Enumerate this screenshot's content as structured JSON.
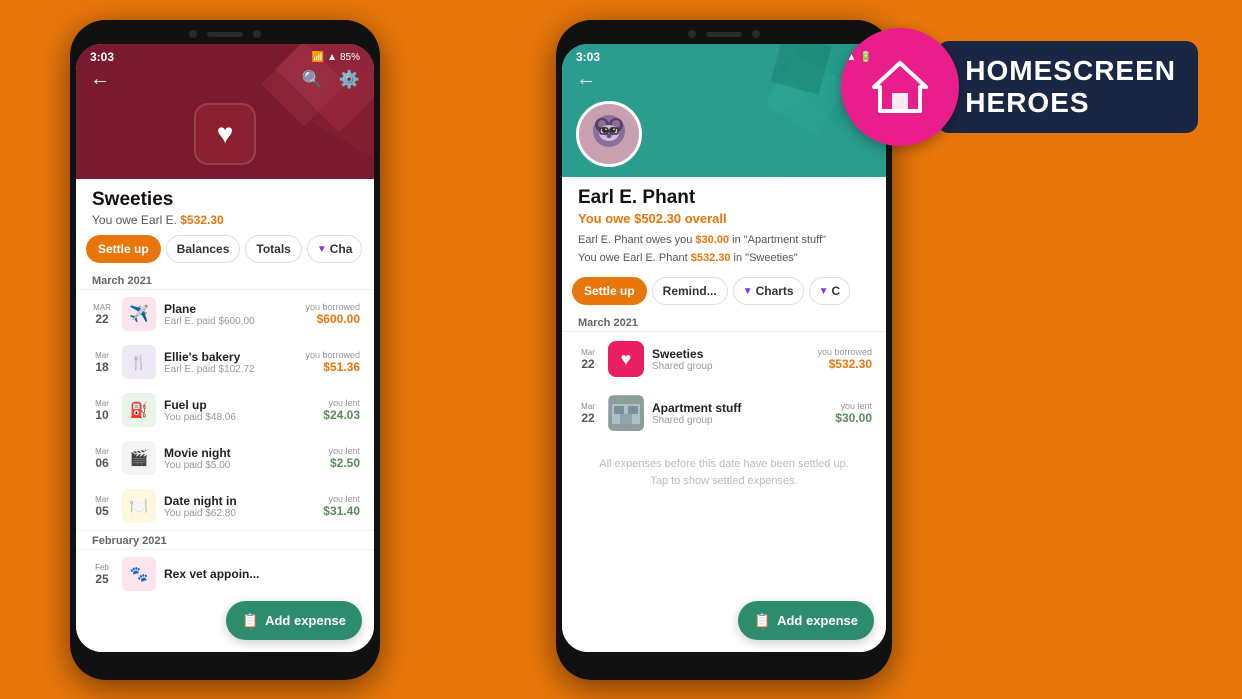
{
  "background_color": "#E8760A",
  "phone1": {
    "status": {
      "time": "3:03",
      "battery": "85%"
    },
    "header": {
      "back_label": "←",
      "search_label": "🔍",
      "settings_label": "⚙"
    },
    "group_name": "Sweeties",
    "group_subtitle": "You owe Earl E.",
    "owe_amount": "$532.30",
    "tabs": [
      {
        "label": "Settle up",
        "active": true
      },
      {
        "label": "Balances",
        "active": false
      },
      {
        "label": "Totals",
        "active": false
      },
      {
        "label": "Cha...",
        "active": false,
        "has_icon": true
      }
    ],
    "month_label": "March 2021",
    "expenses": [
      {
        "month": "Mar",
        "day": "22",
        "icon": "✈",
        "icon_bg": "pink",
        "name": "Plane",
        "payer": "Earl E. paid $600.00",
        "status": "you borrowed",
        "amount": "$600.00",
        "type": "borrowed"
      },
      {
        "month": "Mar",
        "day": "18",
        "icon": "🍴",
        "icon_bg": "purple",
        "name": "Ellie's bakery",
        "payer": "Earl E. paid $102.72",
        "status": "you borrowed",
        "amount": "$51.36",
        "type": "borrowed"
      },
      {
        "month": "Mar",
        "day": "10",
        "icon": "⛽",
        "icon_bg": "green",
        "name": "Fuel up",
        "payer": "You paid $48.06",
        "status": "you lent",
        "amount": "$24.03",
        "type": "lent"
      },
      {
        "month": "Mar",
        "day": "06",
        "icon": "🎬",
        "icon_bg": "gray",
        "name": "Movie night",
        "payer": "You paid $5.00",
        "status": "you lent",
        "amount": "$2.50",
        "type": "lent"
      },
      {
        "month": "Mar",
        "day": "05",
        "icon": "🍽",
        "icon_bg": "yellow",
        "name": "Date night in",
        "payer": "You paid $62.80",
        "status": "you lent",
        "amount": "$31.40",
        "type": "lent"
      }
    ],
    "february_label": "February 2021",
    "february_expense": {
      "month": "Feb",
      "day": "25",
      "icon": "🐾",
      "icon_bg": "pink",
      "name": "Rex vet appoin...",
      "payer": "",
      "status": "",
      "amount": "",
      "type": ""
    },
    "add_expense_label": "Add expense"
  },
  "phone2": {
    "status": {
      "time": "3:03"
    },
    "header": {
      "back_label": "←"
    },
    "contact_name": "Earl E. Phant",
    "owe_overall": "You owe $502.30 overall",
    "owe_details": [
      "Earl E. Phant owes you $30.00 in \"Apartment stuff\"",
      "You owe Earl E. Phant $532.30 in \"Sweeties\""
    ],
    "owe_detail_amounts": [
      "$30.00",
      "$532.30"
    ],
    "tabs": [
      {
        "label": "Settle up",
        "active": true
      },
      {
        "label": "Remind...",
        "active": false
      },
      {
        "label": "Charts",
        "active": false,
        "has_icon": true
      },
      {
        "label": "C",
        "active": false,
        "has_icon": true
      }
    ],
    "month_label": "March 2021",
    "expenses": [
      {
        "month": "Mar",
        "day": "22",
        "icon_type": "heart",
        "name": "Sweeties",
        "sub": "Shared group",
        "status": "you borrowed",
        "amount": "$532.30",
        "type": "borrowed"
      },
      {
        "month": "Mar",
        "day": "22",
        "icon_type": "apartment",
        "name": "Apartment stuff",
        "sub": "Shared group",
        "status": "you lent",
        "amount": "$30.00",
        "type": "lent"
      }
    ],
    "settled_text": "All expenses before this date have been settled up. Tap to show settled expenses.",
    "add_expense_label": "Add expense"
  },
  "badge": {
    "line1": "HOMESCREEN",
    "line2": "HEROES"
  }
}
